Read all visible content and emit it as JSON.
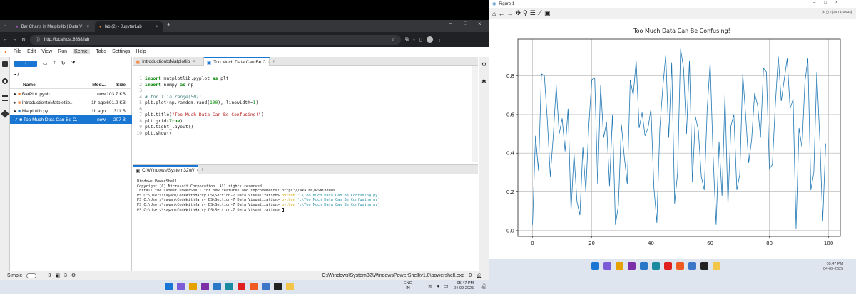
{
  "browser": {
    "tabs": [
      {
        "label": "Bar Charts in Matplotlib | Data V",
        "active": false
      },
      {
        "label": "lab (2) - JupyterLab",
        "active": true
      }
    ],
    "url": "http://localhost:8888/lab"
  },
  "jupyter": {
    "menu": [
      "File",
      "Edit",
      "View",
      "Run",
      "Kernel",
      "Tabs",
      "Settings",
      "Help"
    ],
    "active_menu": "Kernel",
    "new_button": "+",
    "breadcrumb": "/",
    "file_columns": {
      "name": "Name",
      "modified": "Mod...",
      "size": "Size"
    },
    "files": [
      {
        "name": "BarPlot.ipynb",
        "modified": "now",
        "size": "103.7 KB",
        "selected": false
      },
      {
        "name": "IntroductiontoMatplotlib...",
        "modified": "1h ago",
        "size": "601.9 KB",
        "selected": false
      },
      {
        "name": "Matplotlib.py",
        "modified": "1h ago",
        "size": "311 B",
        "selected": false
      },
      {
        "name": "Too Much Data Can Be C...",
        "modified": "now",
        "size": "207 B",
        "selected": true
      }
    ],
    "editor_tabs": [
      "IntroductiontoMatplotlib",
      "Too Much Data Can Be C"
    ],
    "code_lines": [
      {
        "n": "1",
        "parts": [
          {
            "t": "import",
            "c": "kw"
          },
          {
            "t": " matplotlib.pyplot ",
            "c": ""
          },
          {
            "t": "as",
            "c": "kw"
          },
          {
            "t": " plt",
            "c": ""
          }
        ]
      },
      {
        "n": "2",
        "parts": [
          {
            "t": "import",
            "c": "kw"
          },
          {
            "t": " numpy ",
            "c": ""
          },
          {
            "t": "as",
            "c": "kw"
          },
          {
            "t": " np",
            "c": ""
          }
        ]
      },
      {
        "n": "3",
        "parts": []
      },
      {
        "n": "4",
        "parts": [
          {
            "t": "# for i in range(50):",
            "c": "cm"
          }
        ]
      },
      {
        "n": "5",
        "parts": [
          {
            "t": "plt.plot(np.random.rand(",
            "c": ""
          },
          {
            "t": "100",
            "c": "num"
          },
          {
            "t": "), linewidth=",
            "c": ""
          },
          {
            "t": "1",
            "c": "num"
          },
          {
            "t": ")",
            "c": ""
          }
        ]
      },
      {
        "n": "6",
        "parts": []
      },
      {
        "n": "7",
        "parts": [
          {
            "t": "plt.title(",
            "c": ""
          },
          {
            "t": "\"Too Much Data Can Be Confusing!\"",
            "c": "str"
          },
          {
            "t": ")",
            "c": ""
          }
        ]
      },
      {
        "n": "8",
        "parts": [
          {
            "t": "plt.grid(",
            "c": ""
          },
          {
            "t": "True",
            "c": "kw"
          },
          {
            "t": ")",
            "c": ""
          }
        ]
      },
      {
        "n": "9",
        "parts": [
          {
            "t": "plt.tight_layout()",
            "c": ""
          }
        ]
      },
      {
        "n": "10",
        "parts": [
          {
            "t": "plt.show()",
            "c": ""
          }
        ]
      }
    ],
    "terminal_tab": "C:\\Windows\\System32\\W",
    "terminal_lines": [
      "Windows PowerShell",
      "Copyright (C) Microsoft Corporation. All rights reserved.",
      "",
      "Install the latest PowerShell for new features and improvements! https://aka.ms/PSWindows",
      ""
    ],
    "prompt": "PS C:\\Users\\sayan\\CodeWithHarry DS\\Section-7 Data Visualization> ",
    "prompt_cmd": "python",
    "prompt_arg": " '.\\Too Much Data Can Be Confusing.py'",
    "status": {
      "mode": "Simple",
      "count1": "3",
      "count2": "3",
      "path": "C:\\Windows\\System32\\WindowsPowerShell\\v1.0\\powershell.exe",
      "zero": "0"
    }
  },
  "taskbar": {
    "lang1": "ENG",
    "lang2": "IN",
    "time": "05:47 PM",
    "date": "04-09-2025"
  },
  "figure": {
    "window_title": "Figure 1",
    "coord_readout": "(x, y) = (34.78, 0.633)"
  },
  "colors": {
    "line": "#1f77b4",
    "accent": "#1976d2",
    "jupyter": "#f37726"
  },
  "chart_data": {
    "type": "line",
    "title": "Too Much Data Can Be Confusing!",
    "xlim": [
      -4.95,
      103.95
    ],
    "ylim": [
      -0.03,
      0.99
    ],
    "xticks": [
      0,
      20,
      40,
      60,
      80,
      100
    ],
    "yticks": [
      0.0,
      0.2,
      0.4,
      0.6,
      0.8
    ],
    "grid": true,
    "series": [
      {
        "values": [
          0.03,
          0.49,
          0.31,
          0.81,
          0.8,
          0.57,
          0.28,
          0.49,
          0.75,
          0.5,
          0.58,
          0.41,
          0.63,
          0.1,
          0.4,
          0.15,
          0.08,
          0.43,
          0.2,
          0.54,
          0.78,
          0.79,
          0.24,
          0.75,
          0.48,
          0.56,
          0.23,
          0.6,
          0.03,
          0.13,
          0.55,
          0.38,
          0.24,
          0.78,
          0.7,
          0.88,
          0.53,
          0.61,
          0.49,
          0.53,
          0.63,
          0.22,
          0.04,
          0.53,
          0.74,
          0.91,
          0.48,
          0.87,
          0.14,
          0.3,
          0.94,
          0.84,
          0.5,
          0.88,
          0.25,
          0.59,
          0.52,
          0.28,
          0.21,
          0.63,
          0.87,
          0.38,
          0.03,
          0.46,
          0.18,
          0.7,
          0.13,
          0.54,
          0.6,
          0.21,
          0.29,
          0.81,
          0.59,
          0.35,
          0.47,
          0.71,
          0.65,
          0.48,
          0.84,
          0.82,
          0.32,
          0.34,
          0.65,
          0.9,
          0.67,
          0.78,
          0.89,
          0.63,
          0.68,
          0.01,
          0.53,
          0.43,
          0.77,
          0.89,
          0.21,
          0.3,
          0.82,
          0.48,
          0.05,
          0.45
        ]
      }
    ]
  }
}
